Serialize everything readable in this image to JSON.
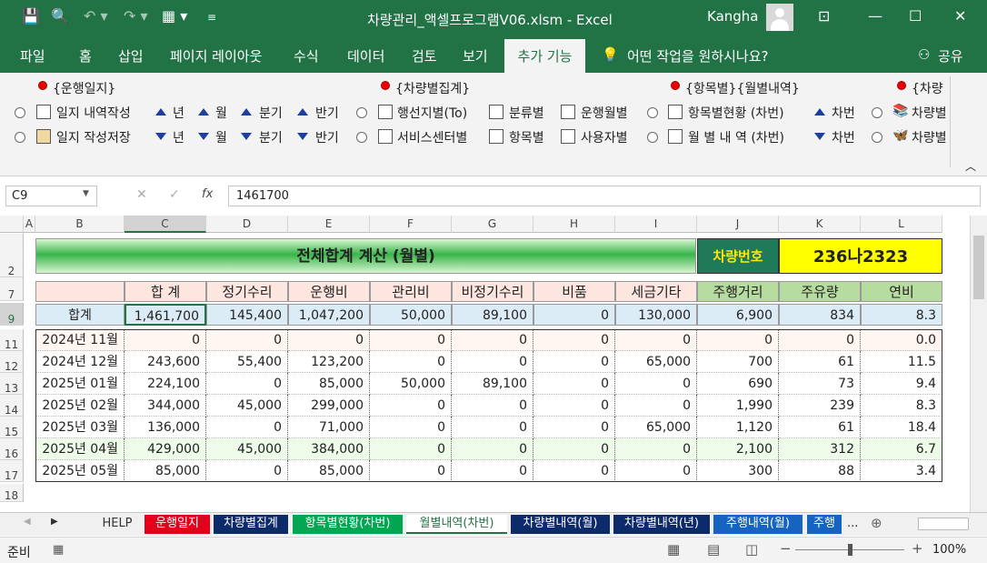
{
  "window": {
    "title": "차량관리_액셀프로그램V06.xlsm  -  Excel",
    "user": "Kangha"
  },
  "menu": {
    "items": [
      "파일",
      "홈",
      "삽입",
      "페이지 레이아웃",
      "수식",
      "데이터",
      "검토",
      "보기"
    ],
    "active": "추가 기능",
    "tell_me": "어떤 작업을 원하시나요?",
    "share": "공유"
  },
  "ribbon": {
    "group1": {
      "title": "{운행일지}",
      "btn1": "일지 내역작성",
      "btn2": "일지 작성저장",
      "up": [
        "년",
        "월",
        "분기",
        "반기"
      ],
      "down": [
        "년",
        "월",
        "분기",
        "반기"
      ]
    },
    "group2": {
      "title": "{차량별집계}",
      "r1": [
        "행선지별(To)",
        "분류별",
        "운행월별"
      ],
      "r2": [
        "서비스센터별",
        "항목별",
        "사용자별"
      ]
    },
    "group3": {
      "title": "{항목별}{월별내역}",
      "r1": "항목별현황 (차번)",
      "r2": "월 별 내 역 (차번)",
      "up": "차번",
      "down": "차번"
    },
    "group4": {
      "title": "{차량",
      "r1": "차량별",
      "r2": "차량별"
    }
  },
  "formula": {
    "cell_ref": "C9",
    "value": "1461700"
  },
  "columns": [
    "A",
    "B",
    "C",
    "D",
    "E",
    "F",
    "G",
    "H",
    "I",
    "J",
    "K",
    "L"
  ],
  "rows": [
    "2",
    "7",
    "9",
    "11",
    "12",
    "13",
    "14",
    "15",
    "16",
    "17",
    "18"
  ],
  "sheet": {
    "title": "전체합계 계산 (월별)",
    "car_label": "차량번호",
    "car_no": "236나2323",
    "headers": [
      "",
      "합  계",
      "정기수리",
      "운행비",
      "관리비",
      "비정기수리",
      "비품",
      "세금기타",
      "주행거리",
      "주유량",
      "연비"
    ],
    "total_row": [
      "합계",
      "1,461,700",
      "145,400",
      "1,047,200",
      "50,000",
      "89,100",
      "0",
      "130,000",
      "6,900",
      "834",
      "8.3"
    ],
    "data": [
      [
        "2024년 11월",
        "0",
        "0",
        "0",
        "0",
        "0",
        "0",
        "0",
        "0",
        "0",
        "0.0"
      ],
      [
        "2024년 12월",
        "243,600",
        "55,400",
        "123,200",
        "0",
        "0",
        "0",
        "65,000",
        "700",
        "61",
        "11.5"
      ],
      [
        "2025년 01월",
        "224,100",
        "0",
        "85,000",
        "50,000",
        "89,100",
        "0",
        "0",
        "690",
        "73",
        "9.4"
      ],
      [
        "2025년 02월",
        "344,000",
        "45,000",
        "299,000",
        "0",
        "0",
        "0",
        "0",
        "1,990",
        "239",
        "8.3"
      ],
      [
        "2025년 03월",
        "136,000",
        "0",
        "71,000",
        "0",
        "0",
        "0",
        "65,000",
        "1,120",
        "61",
        "18.4"
      ],
      [
        "2025년 04월",
        "429,000",
        "45,000",
        "384,000",
        "0",
        "0",
        "0",
        "0",
        "2,100",
        "312",
        "6.7"
      ],
      [
        "2025년 05월",
        "85,000",
        "0",
        "85,000",
        "0",
        "0",
        "0",
        "0",
        "300",
        "88",
        "3.4"
      ]
    ]
  },
  "tabs": [
    {
      "label": "HELP",
      "bg": "#f0f0f0",
      "fg": "#333"
    },
    {
      "label": "운행일지",
      "bg": "#e3001b",
      "fg": "#fff"
    },
    {
      "label": "차량별집계",
      "bg": "#0d2a6b",
      "fg": "#fff"
    },
    {
      "label": "항목별현황(차번)",
      "bg": "#00a651",
      "fg": "#fff"
    },
    {
      "label": "월별내역(차번)",
      "bg": "#ffffff",
      "fg": "#217346"
    },
    {
      "label": "차량별내역(월)",
      "bg": "#0d2a6b",
      "fg": "#fff"
    },
    {
      "label": "차량별내역(년)",
      "bg": "#0d2a6b",
      "fg": "#fff"
    },
    {
      "label": "주행내역(월)",
      "bg": "#1565c0",
      "fg": "#fff"
    },
    {
      "label": "주행",
      "bg": "#1565c0",
      "fg": "#fff"
    }
  ],
  "status": {
    "ready": "준비",
    "zoom": "100%"
  }
}
